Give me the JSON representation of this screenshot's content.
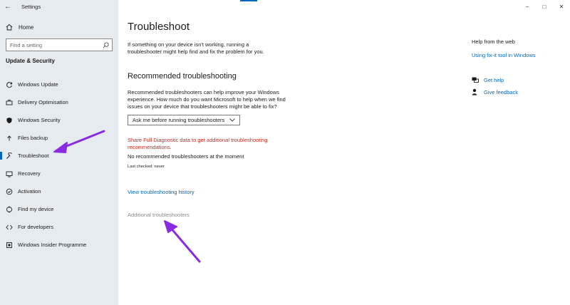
{
  "window": {
    "app_title": "Settings",
    "back_glyph": "←",
    "minimize_glyph": "–",
    "maximize_glyph": "□",
    "close_glyph": "✕"
  },
  "sidebar": {
    "home_label": "Home",
    "search_placeholder": "Find a setting",
    "section_title": "Update & Security",
    "items": [
      {
        "label": "Windows Update",
        "icon": "sync-icon"
      },
      {
        "label": "Delivery Optimisation",
        "icon": "delivery-icon"
      },
      {
        "label": "Windows Security",
        "icon": "shield-icon"
      },
      {
        "label": "Files backup",
        "icon": "backup-icon"
      },
      {
        "label": "Troubleshoot",
        "icon": "wrench-icon",
        "selected": true
      },
      {
        "label": "Recovery",
        "icon": "recovery-icon"
      },
      {
        "label": "Activation",
        "icon": "activation-icon"
      },
      {
        "label": "Find my device",
        "icon": "location-icon"
      },
      {
        "label": "For developers",
        "icon": "developer-icon"
      },
      {
        "label": "Windows Insider Programme",
        "icon": "insider-icon"
      }
    ]
  },
  "main": {
    "title": "Troubleshoot",
    "intro": "If something on your device isn't working, running a troubleshooter might help find and fix the problem for you.",
    "recommended_heading": "Recommended troubleshooting",
    "recommended_desc": "Recommended troubleshooters can help improve your Windows experience. How much do you want Microsoft to help when we find issues on your device that troubleshooters might be able to fix?",
    "dropdown_value": "Ask me before running troubleshooters",
    "diagnostic_link": "Share Full Diagnostic data to get additional troubleshooting recommendations.",
    "no_recommended": "No recommended troubleshooters at the moment",
    "last_checked": "Last checked: never",
    "history_link": "View troubleshooting history",
    "additional_link": "Additional troubleshooters"
  },
  "right_panel": {
    "help_title": "Help from the web",
    "fixit_link": "Using fix-it tool in Windows",
    "get_help": "Get help",
    "give_feedback": "Give feedback"
  },
  "colors": {
    "accent": "#0067c0",
    "annotation_arrow": "#8a2be2",
    "warning_text": "#c42b1c",
    "sidebar_bg": "#e6ebf0"
  }
}
